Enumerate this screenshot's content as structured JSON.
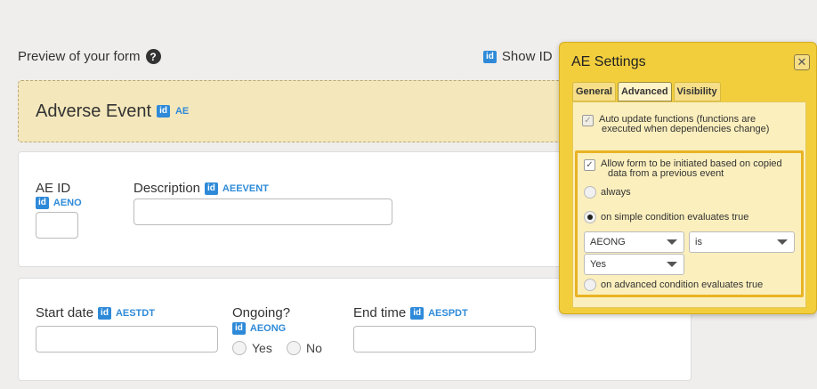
{
  "preview": {
    "title": "Preview of your form",
    "help_icon": "question-circle-icon",
    "help_glyph": "?"
  },
  "show_id": {
    "label": "Show ID"
  },
  "id_badge": "id",
  "form": {
    "title": "Adverse Event",
    "code": "AE"
  },
  "card1": {
    "ae_id": {
      "label": "AE ID",
      "code": "AENO"
    },
    "description": {
      "label": "Description",
      "code": "AEEVENT"
    }
  },
  "card2": {
    "start_date": {
      "label": "Start date",
      "code": "AESTDT"
    },
    "ongoing": {
      "label": "Ongoing?",
      "code": "AEONG",
      "yes": "Yes",
      "no": "No"
    },
    "end_time": {
      "label": "End time",
      "code": "AESPDT"
    }
  },
  "popup": {
    "title": "AE Settings",
    "close_glyph": "✕",
    "tabs": [
      "General",
      "Advanced",
      "Visibility"
    ],
    "auto_update": {
      "line1": "Auto update functions (functions are",
      "line2": "executed when dependencies change)",
      "checked": true
    },
    "allow_copy": {
      "line1": "Allow form to be initiated based on copied",
      "line2": "data from a previous event",
      "checked": true
    },
    "check_glyph": "✓",
    "always": "always",
    "simple_condition": "on simple condition evaluates true",
    "advanced_condition": "on advanced condition evaluates true",
    "dropdowns": {
      "field": "AEONG",
      "operator": "is",
      "value": "Yes"
    }
  },
  "colors": {
    "accent": "#2e8ad8",
    "popup": "#f2ce3d",
    "highlight": "#e9b323"
  }
}
